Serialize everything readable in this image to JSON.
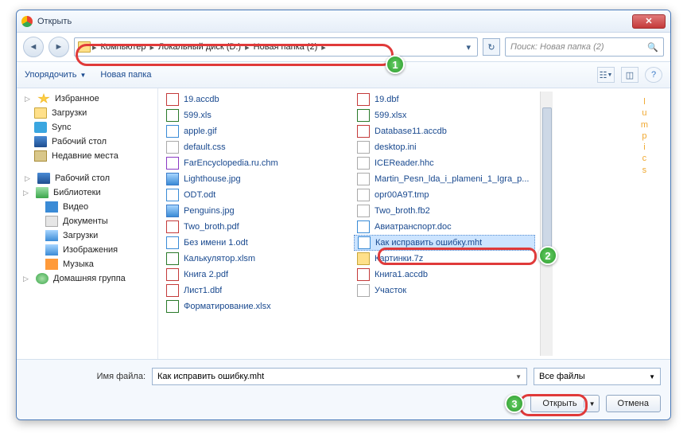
{
  "window": {
    "title": "Открыть"
  },
  "breadcrumb": [
    "Компьютер",
    "Локальный диск (D:)",
    "Новая папка (2)"
  ],
  "search": {
    "placeholder": "Поиск: Новая папка (2)"
  },
  "toolbar": {
    "organize": "Упорядочить",
    "new_folder": "Новая папка"
  },
  "sidebar": {
    "favorites": {
      "label": "Избранное",
      "items": [
        {
          "label": "Загрузки",
          "icon": "folder"
        },
        {
          "label": "Sync",
          "icon": "sync"
        },
        {
          "label": "Рабочий стол",
          "icon": "desk"
        },
        {
          "label": "Недавние места",
          "icon": "recent"
        }
      ]
    },
    "desktop": {
      "label": "Рабочий стол"
    },
    "libraries": {
      "label": "Библиотеки",
      "items": [
        {
          "label": "Видео",
          "icon": "video"
        },
        {
          "label": "Документы",
          "icon": "doc"
        },
        {
          "label": "Загрузки",
          "icon": "pic"
        },
        {
          "label": "Изображения",
          "icon": "pic"
        },
        {
          "label": "Музыка",
          "icon": "music"
        }
      ]
    },
    "homegroup": {
      "label": "Домашняя группа"
    }
  },
  "files": {
    "col1": [
      {
        "name": "19.accdb",
        "type": "db"
      },
      {
        "name": "599.xls",
        "type": "xls"
      },
      {
        "name": "apple.gif",
        "type": "gif"
      },
      {
        "name": "default.css",
        "type": "css"
      },
      {
        "name": "FarEncyclopedia.ru.chm",
        "type": "chm"
      },
      {
        "name": "Lighthouse.jpg",
        "type": "jpg"
      },
      {
        "name": "ODT.odt",
        "type": "odt"
      },
      {
        "name": "Penguins.jpg",
        "type": "jpg"
      },
      {
        "name": "Two_broth.pdf",
        "type": "pdf"
      },
      {
        "name": "Без имени 1.odt",
        "type": "odt"
      },
      {
        "name": "Калькулятор.xlsm",
        "type": "xls"
      },
      {
        "name": "Книга 2.pdf",
        "type": "pdf"
      },
      {
        "name": "Лист1.dbf",
        "type": "db"
      },
      {
        "name": "Форматирование.xlsx",
        "type": "xls"
      }
    ],
    "col2": [
      {
        "name": "19.dbf",
        "type": "db"
      },
      {
        "name": "599.xlsx",
        "type": "xls"
      },
      {
        "name": "Database11.accdb",
        "type": "db"
      },
      {
        "name": "desktop.ini",
        "type": "css"
      },
      {
        "name": "ICEReader.hhc",
        "type": "css"
      },
      {
        "name": "Martin_Pesn_lda_i_plameni_1_Igra_p...",
        "type": "css"
      },
      {
        "name": "opr00A9T.tmp",
        "type": "css"
      },
      {
        "name": "Two_broth.fb2",
        "type": "css"
      },
      {
        "name": "Авиатранспорт.doc",
        "type": "odt"
      },
      {
        "name": "Как исправить ошибку.mht",
        "type": "mht",
        "selected": true
      },
      {
        "name": "Картинки.7z",
        "type": "z7"
      },
      {
        "name": "Книга1.accdb",
        "type": "db"
      },
      {
        "name": "Участок",
        "type": "css"
      }
    ]
  },
  "bottom": {
    "filename_label": "Имя файла:",
    "filename_value": "Как исправить ошибку.mht",
    "filter": "Все файлы",
    "open": "Открыть",
    "cancel": "Отмена"
  },
  "watermark": [
    "l",
    "u",
    "m",
    "p",
    "i",
    "c",
    "s"
  ],
  "callouts": {
    "1": "1",
    "2": "2",
    "3": "3"
  }
}
